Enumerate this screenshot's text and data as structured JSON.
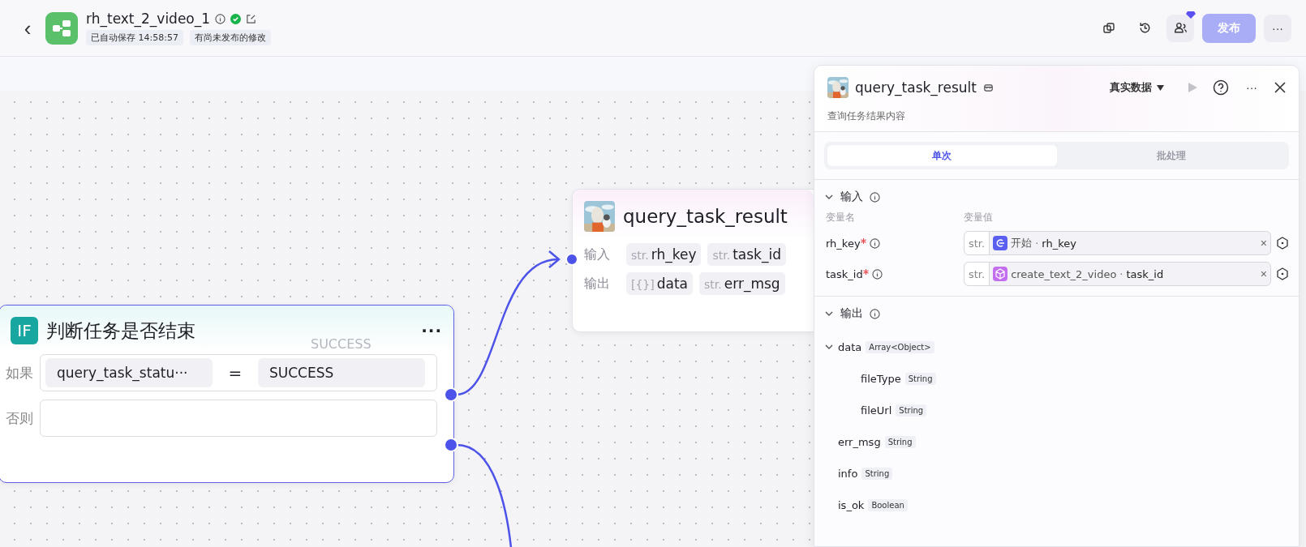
{
  "header": {
    "back": "‹",
    "title": "rh_text_2_video_1",
    "tags": [
      "已自动保存 14:58:57",
      "有尚未发布的修改"
    ],
    "publish_button": "发布",
    "publish_disabled": true,
    "more": "···"
  },
  "canvas": {
    "if_node": {
      "icon_text": "IF",
      "title": "判断任务是否结束",
      "more": "···",
      "ghost_label": "SUCCESS",
      "branches": [
        {
          "label": "如果",
          "left": "query_task_statu···",
          "operator": "=",
          "right": "SUCCESS"
        },
        {
          "label": "否则"
        }
      ]
    },
    "task_node": {
      "title": "query_task_result",
      "rows": [
        {
          "label": "输入",
          "params": [
            {
              "type": "str.",
              "name": "rh_key"
            },
            {
              "type": "str.",
              "name": "task_id"
            }
          ]
        },
        {
          "label": "输出",
          "params": [
            {
              "type": "[{}]",
              "name": "data"
            },
            {
              "type": "str.",
              "name": "err_msg"
            }
          ]
        }
      ]
    }
  },
  "panel": {
    "title": "query_task_result",
    "subtitle": "查询任务结果内容",
    "data_mode": "真实数据",
    "more": "···",
    "tabs": [
      {
        "label": "单次",
        "selected": true
      },
      {
        "label": "批处理",
        "selected": false
      }
    ],
    "inputs": {
      "title": "输入",
      "expanded": true,
      "col_name": "变量名",
      "col_value": "变量值",
      "rows": [
        {
          "name": "rh_key",
          "required": true,
          "type": "str.",
          "kind": "start",
          "source": "开始",
          "separator": "·",
          "variable": "rh_key",
          "clear": "×"
        },
        {
          "name": "task_id",
          "required": true,
          "type": "str.",
          "kind": "node",
          "source": "create_text_2_video",
          "separator": "·",
          "variable": "task_id",
          "clear": "×"
        }
      ]
    },
    "outputs": {
      "title": "输出",
      "expanded": true,
      "items": [
        {
          "name": "data",
          "type": "Array<Object>",
          "expanded": true,
          "children": [
            {
              "name": "fileType",
              "type": "String"
            },
            {
              "name": "fileUrl",
              "type": "String"
            }
          ]
        },
        {
          "name": "err_msg",
          "type": "String"
        },
        {
          "name": "info",
          "type": "String"
        },
        {
          "name": "is_ok",
          "type": "Boolean"
        }
      ]
    }
  }
}
